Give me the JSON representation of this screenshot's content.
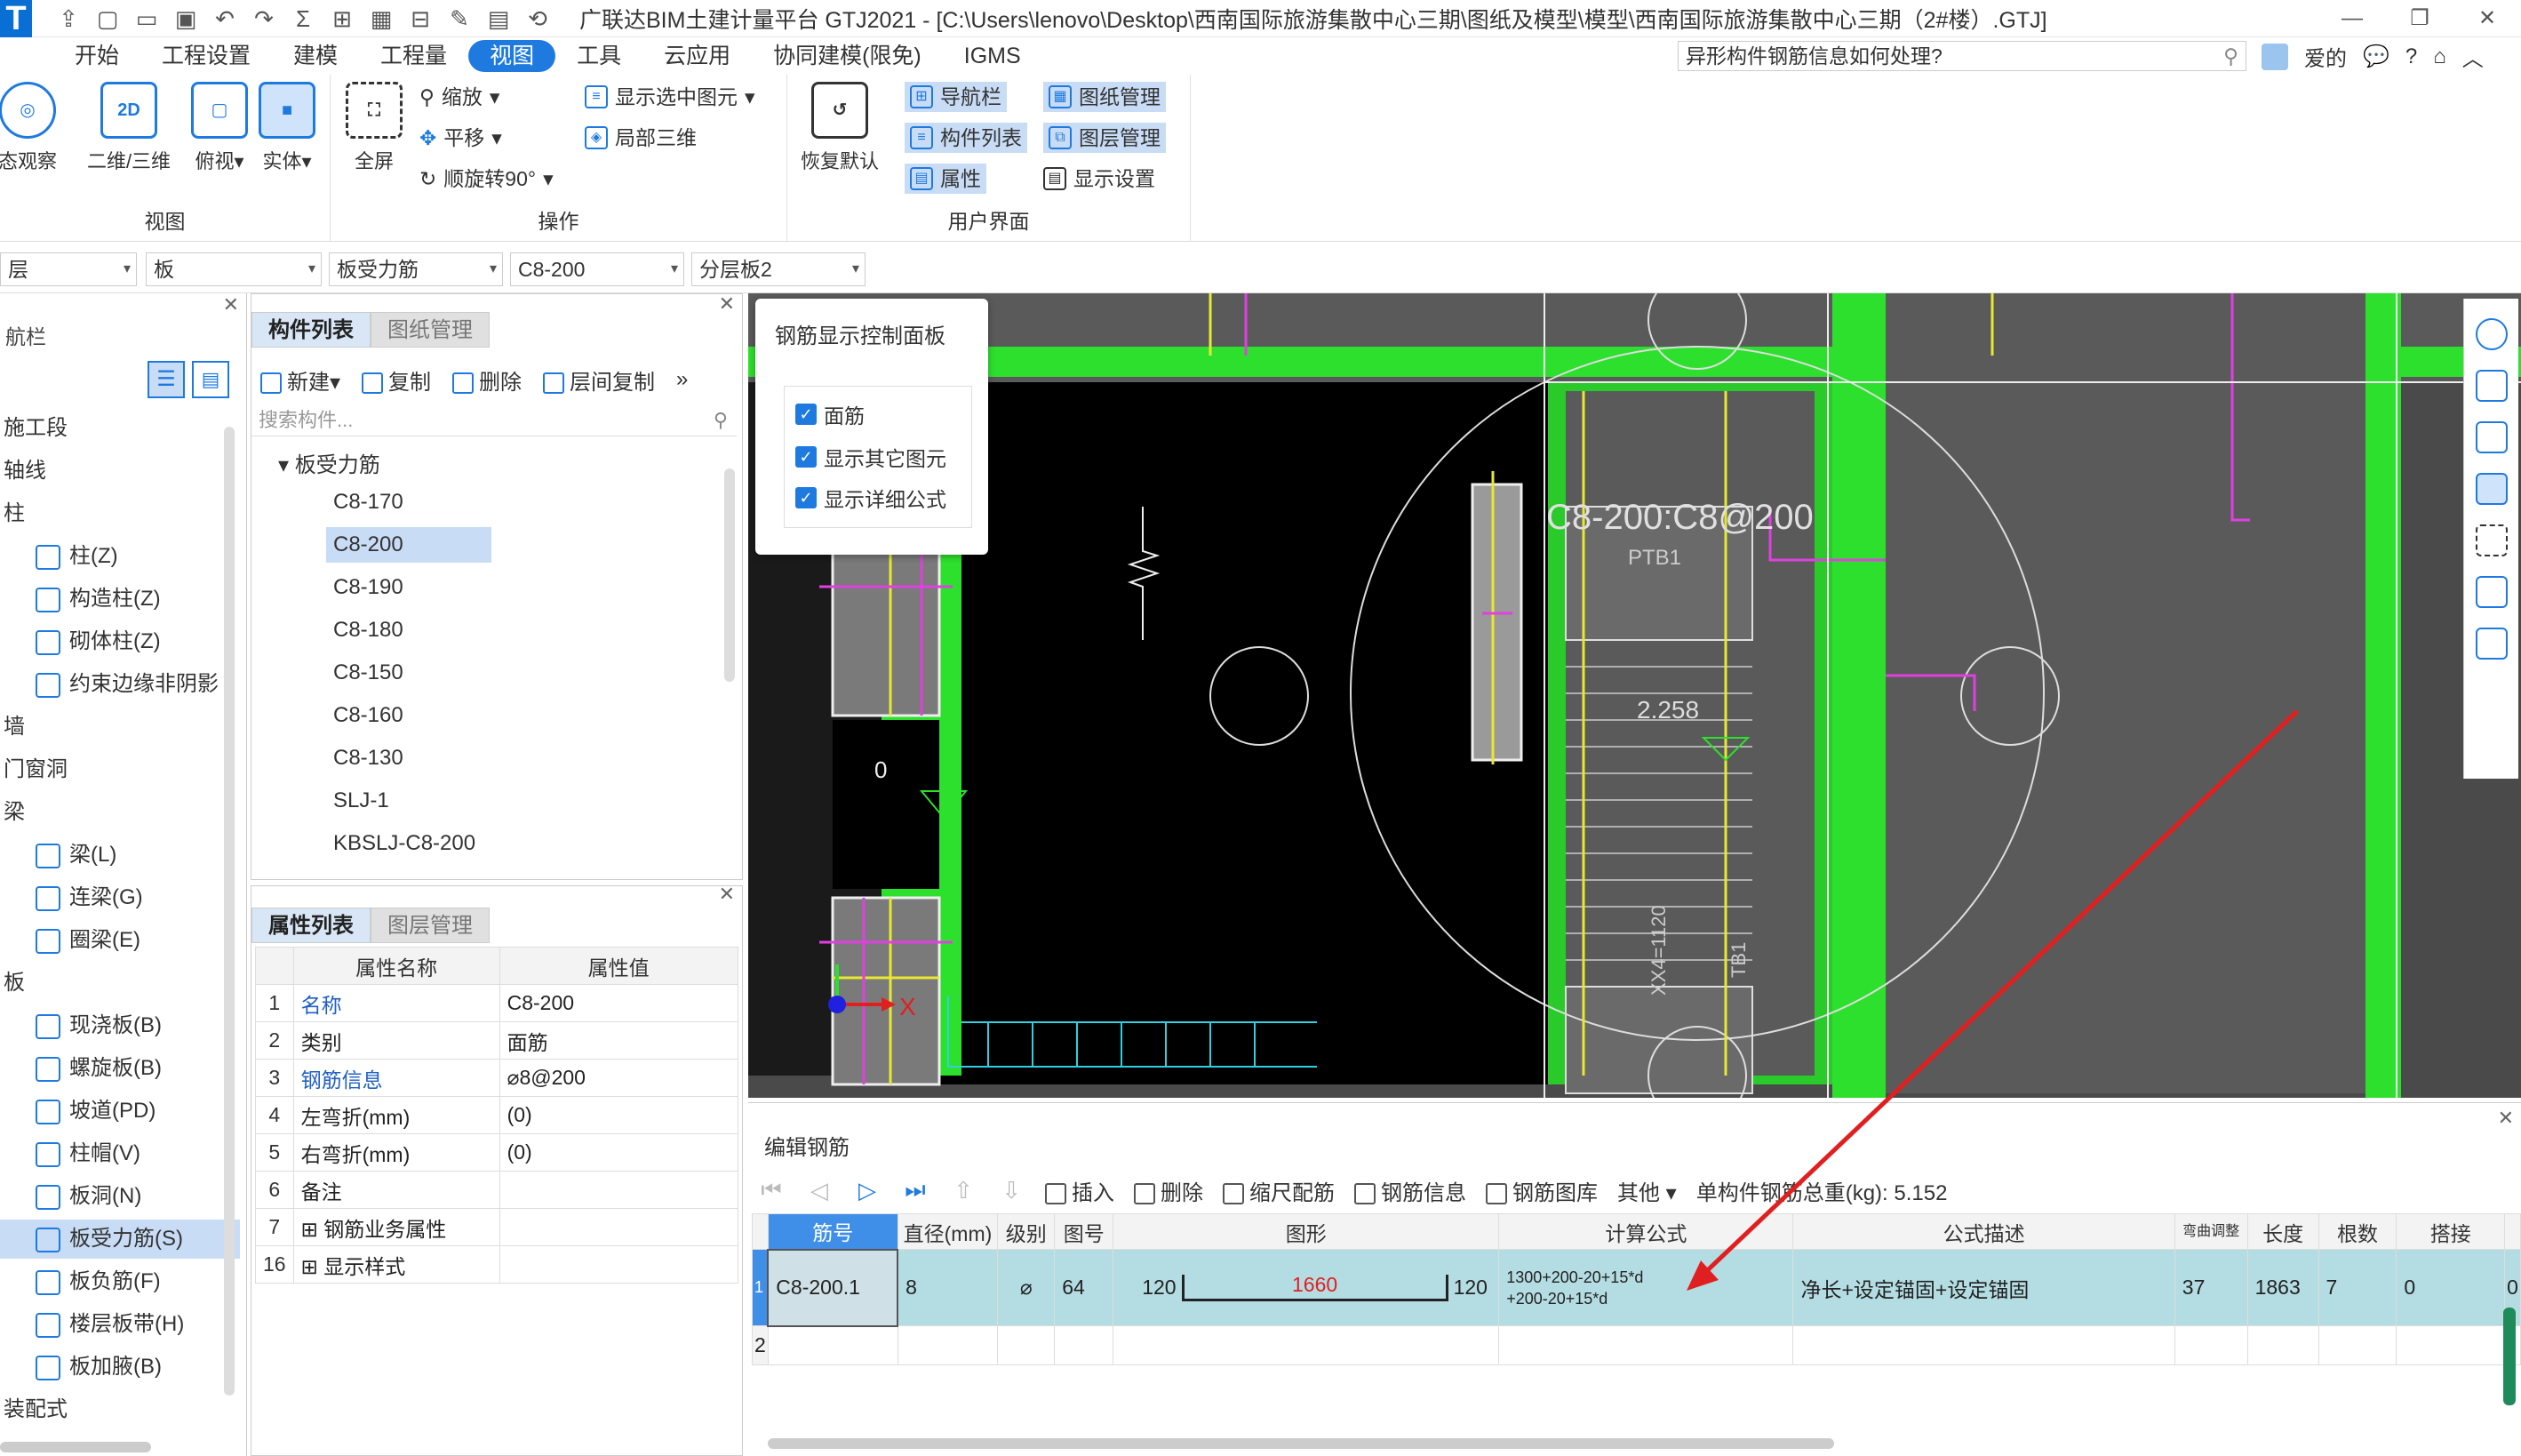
{
  "app": {
    "title": "广联达BIM土建计量平台 GTJ2021 - [C:\\Users\\lenovo\\Desktop\\西南国际旅游集散中心三期\\图纸及模型\\模型\\西南国际旅游集散中心三期（2#楼）.GTJ]",
    "logo_letter": "T"
  },
  "menu": {
    "items": [
      "开始",
      "工程设置",
      "建模",
      "工程量",
      "视图",
      "工具",
      "云应用",
      "协同建模(限免)",
      "IGMS"
    ],
    "active_index": 4,
    "search_text": "异形构件钢筋信息如何处理?",
    "user": "爱的"
  },
  "ribbon": {
    "view_group": {
      "label": "视图",
      "buttons": [
        "态观察",
        "二维/三维",
        "俯视",
        "实体"
      ]
    },
    "ops_group": {
      "label": "操作",
      "fullscreen": "全屏",
      "zoom": "缩放",
      "pan": "平移",
      "rotate": "顺旋转90°",
      "show_selected": "显示选中图元",
      "local_3d": "局部三维"
    },
    "ui_group": {
      "label": "用户界面",
      "restore": "恢复默认",
      "nav": "导航栏",
      "complist": "构件列表",
      "props": "属性",
      "drawing_mgmt": "图纸管理",
      "layer_mgmt": "图层管理",
      "display_settings": "显示设置"
    }
  },
  "filters": [
    "层",
    "板",
    "板受力筋",
    "C8-200",
    "分层板2"
  ],
  "nav": {
    "title": "航栏",
    "items": [
      {
        "label": "施工段",
        "sub": false
      },
      {
        "label": "轴线",
        "sub": false
      },
      {
        "label": "柱",
        "sub": false
      },
      {
        "label": "柱(Z)",
        "sub": true
      },
      {
        "label": "构造柱(Z)",
        "sub": true
      },
      {
        "label": "砌体柱(Z)",
        "sub": true
      },
      {
        "label": "约束边缘非阴影",
        "sub": true
      },
      {
        "label": "墙",
        "sub": false
      },
      {
        "label": "门窗洞",
        "sub": false
      },
      {
        "label": "梁",
        "sub": false
      },
      {
        "label": "梁(L)",
        "sub": true
      },
      {
        "label": "连梁(G)",
        "sub": true
      },
      {
        "label": "圈梁(E)",
        "sub": true
      },
      {
        "label": "板",
        "sub": false
      },
      {
        "label": "现浇板(B)",
        "sub": true
      },
      {
        "label": "螺旋板(B)",
        "sub": true
      },
      {
        "label": "坡道(PD)",
        "sub": true
      },
      {
        "label": "柱帽(V)",
        "sub": true
      },
      {
        "label": "板洞(N)",
        "sub": true
      },
      {
        "label": "板受力筋(S)",
        "sub": true
      },
      {
        "label": "板负筋(F)",
        "sub": true
      },
      {
        "label": "楼层板带(H)",
        "sub": true
      },
      {
        "label": "板加腋(B)",
        "sub": true
      },
      {
        "label": "装配式",
        "sub": false
      }
    ],
    "selected_index": 19
  },
  "complist": {
    "tabs": [
      "构件列表",
      "图纸管理"
    ],
    "toolbar": [
      "新建",
      "复制",
      "删除",
      "层间复制"
    ],
    "search_placeholder": "搜索构件...",
    "root": "板受力筋",
    "items": [
      "C8-170",
      "C8-200",
      "C8-190",
      "C8-180",
      "C8-150",
      "C8-160",
      "C8-130",
      "SLJ-1",
      "KBSLJ-C8-200"
    ],
    "selected_index": 1
  },
  "props": {
    "tabs": [
      "属性列表",
      "图层管理"
    ],
    "headers": [
      "属性名称",
      "属性值"
    ],
    "rows": [
      {
        "n": "1",
        "name": "名称",
        "value": "C8-200",
        "blue": true
      },
      {
        "n": "2",
        "name": "类别",
        "value": "面筋",
        "blue": false
      },
      {
        "n": "3",
        "name": "钢筋信息",
        "value": "⌀8@200",
        "blue": true
      },
      {
        "n": "4",
        "name": "左弯折(mm)",
        "value": "(0)",
        "blue": false
      },
      {
        "n": "5",
        "name": "右弯折(mm)",
        "value": "(0)",
        "blue": false
      },
      {
        "n": "6",
        "name": "备注",
        "value": "",
        "blue": false
      },
      {
        "n": "7",
        "name": "钢筋业务属性",
        "value": "",
        "blue": false
      },
      {
        "n": "16",
        "name": "显示样式",
        "value": "",
        "blue": false
      }
    ]
  },
  "ctrlpanel": {
    "title": "钢筋显示控制面板",
    "checkboxes": [
      "面筋",
      "显示其它图元",
      "显示详细公式"
    ]
  },
  "viewport": {
    "label_main": "C8-200:C8@200",
    "label_elev": "2.258",
    "label_ptb": "PTB1",
    "label_dim": "XX4=1120",
    "label_tb": "TB1",
    "axis_x": "X",
    "label_zero": "0"
  },
  "editor": {
    "title": "编辑钢筋",
    "toolbar": [
      "插入",
      "删除",
      "缩尺配筋",
      "钢筋信息",
      "钢筋图库",
      "其他"
    ],
    "total_weight": "单构件钢筋总重(kg): 5.152",
    "headers": [
      "筋号",
      "直径(mm)",
      "级别",
      "图号",
      "图形",
      "计算公式",
      "公式描述",
      "弯曲调整",
      "长度",
      "根数",
      "搭接"
    ],
    "row": {
      "index": "1",
      "bar_no": "C8-200.1",
      "diameter": "8",
      "grade": "⌀",
      "fig_no": "64",
      "shape_left": "120",
      "shape_mid": "1660",
      "shape_right": "120",
      "formula_line1": "1300+200-20+15*d",
      "formula_line2": "+200-20+15*d",
      "desc": "净长+设定锚固+设定锚固",
      "bend": "37",
      "length": "1863",
      "count": "7",
      "lap": "0",
      "extra": "0"
    },
    "row2_index": "2"
  },
  "colors": {
    "accent": "#1f7ae0",
    "green_rebar": "#2ee02e",
    "magenta_rebar": "#e040e0",
    "yellow_rebar": "#e8e830",
    "cyan_line": "#30d0e0",
    "red_arrow": "#e02020"
  }
}
